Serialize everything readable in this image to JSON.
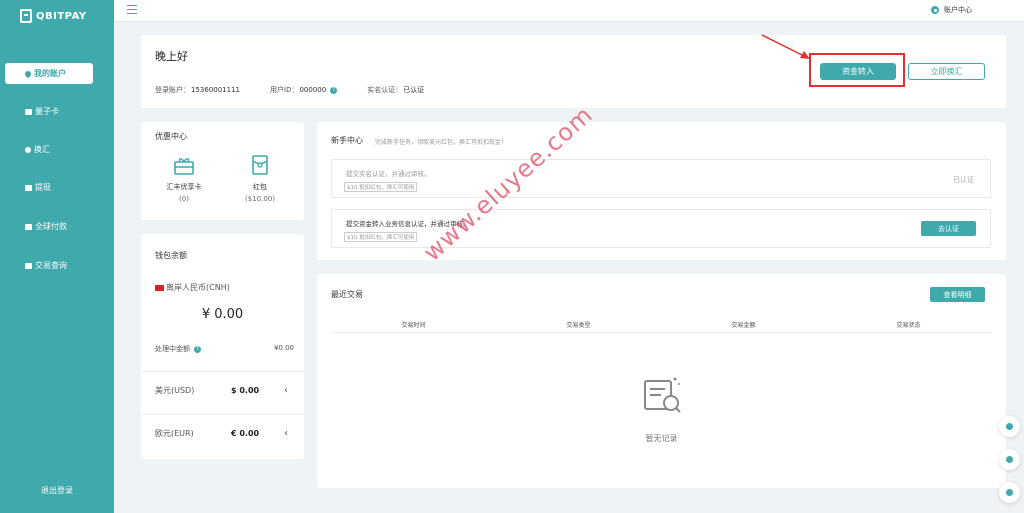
{
  "brand": {
    "name": "QBITPAY"
  },
  "sidebar": {
    "items": [
      {
        "label": "我的账户",
        "icon": "pin-icon",
        "active": true
      },
      {
        "label": "量子卡",
        "icon": "card-icon"
      },
      {
        "label": "换汇",
        "icon": "exchange-icon"
      },
      {
        "label": "提现",
        "icon": "withdraw-icon"
      },
      {
        "label": "全球付款",
        "icon": "payment-icon"
      },
      {
        "label": "交易查询",
        "icon": "query-icon"
      }
    ],
    "logout": "退出登录"
  },
  "topbar": {
    "account_center": "账户中心"
  },
  "greeting": {
    "title": "晚上好",
    "login_label": "登录账户：",
    "login_value": "15360001111",
    "userid_label": "用户ID：",
    "userid_value": "000000",
    "verify_label": "实名认证：",
    "verify_value": "已认证",
    "transfer_button": "资金转入",
    "exchange_button": "立即换汇"
  },
  "offers": {
    "title": "优惠中心",
    "items": [
      {
        "label": "汇丰优享卡",
        "value": "(0)"
      },
      {
        "label": "红包",
        "value": "($10.00)"
      }
    ]
  },
  "wallet": {
    "title": "钱包余额",
    "cnh_label": "离岸人民币(CNH)",
    "cnh_amount": "¥ 0.00",
    "processing_label": "处理中金额",
    "processing_value": "¥0.00",
    "rows": [
      {
        "label": "美元(USD)",
        "amount": "$ 0.00"
      },
      {
        "label": "欧元(EUR)",
        "amount": "€ 0.00"
      }
    ]
  },
  "newuser": {
    "title": "新手中心",
    "subtitle": "完成新手任务，领取美元红包，换汇可抵扣现金！",
    "tasks": [
      {
        "desc": "提交实名认证，并通过审核。",
        "tag": "$10 抵扣红包，换汇可使用",
        "status": "已认证"
      },
      {
        "desc": "提交资金转入业务信息认证，并通过审核。",
        "tag": "$10 抵扣红包，换汇可使用",
        "button": "去认证"
      }
    ]
  },
  "recent": {
    "title": "最近交易",
    "detail_button": "查看明细",
    "columns": [
      "交易时间",
      "交易类型",
      "交易金额",
      "交易状态"
    ],
    "empty": "暂无记录"
  },
  "watermark": "www.eluyee.com",
  "colors": {
    "brand": "#3fa9ac",
    "highlight": "#e03030"
  }
}
